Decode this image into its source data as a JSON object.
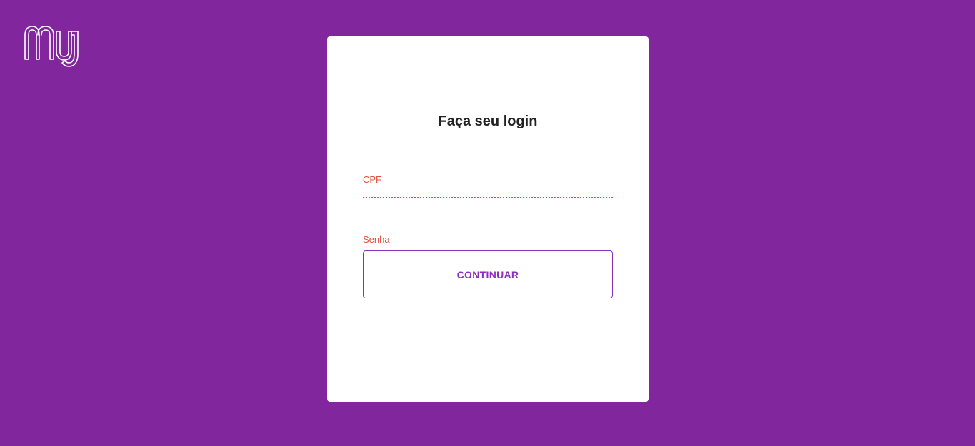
{
  "brand": {
    "logo_icon": "nu-logo-icon",
    "background_color": "#82269e",
    "accent_color": "#8a2ec0",
    "error_color": "#e0533a"
  },
  "login_card": {
    "title": "Faça seu login",
    "fields": [
      {
        "label": "CPF",
        "value": ""
      },
      {
        "label": "Senha",
        "value": ""
      }
    ],
    "continue_label": "CONTINUAR"
  }
}
